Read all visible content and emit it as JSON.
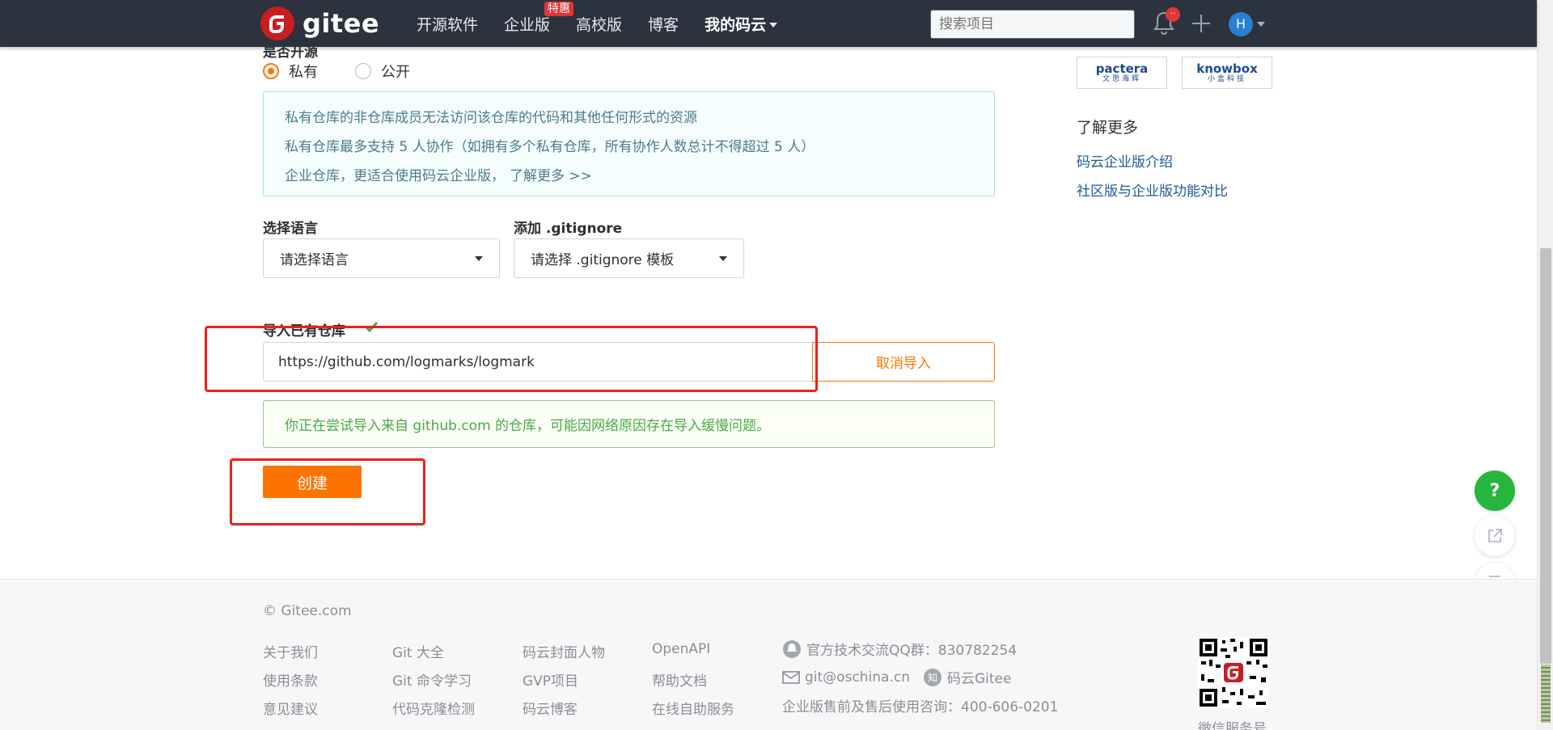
{
  "header": {
    "logo_text": "gitee",
    "nav": [
      "开源软件",
      "企业版",
      "高校版",
      "博客",
      "我的码云"
    ],
    "badge_hot": "特惠",
    "search_placeholder": "搜索项目",
    "avatar_letter": "H"
  },
  "visibility": {
    "private_label": "私有",
    "public_label": "公开",
    "selected": "private"
  },
  "info_box": {
    "line1": "私有仓库的非仓库成员无法访问该仓库的代码和其他任何形式的资源",
    "line2": "私有仓库最多支持 5 人协作（如拥有多个私有仓库，所有协作人数总计不得超过 5 人）",
    "line3": "企业仓库，更适合使用码云企业版，",
    "link": "了解更多 >>"
  },
  "language": {
    "label": "选择语言",
    "value": "请选择语言"
  },
  "gitignore": {
    "label": "添加 .gitignore",
    "value": "请选择 .gitignore 模板"
  },
  "import": {
    "label": "导入已有仓库",
    "url": "https://github.com/logmarks/logmark",
    "cancel_label": "取消导入",
    "notice": "你正在尝试导入来自 github.com 的仓库，可能因网络原因存在导入缓慢问题。"
  },
  "create_label": "创建",
  "sidebar": {
    "partners": [
      {
        "name": "pactera",
        "sub": "文思海辉"
      },
      {
        "name": "knowbox",
        "sub": "小盒科技"
      }
    ],
    "learn_more_title": "了解更多",
    "links": [
      "码云企业版介绍",
      "社区版与企业版功能对比"
    ]
  },
  "floating": {
    "help_label": "?"
  },
  "footer": {
    "copyright": "© Gitee.com",
    "columns": [
      [
        "关于我们",
        "使用条款",
        "意见建议"
      ],
      [
        "Git 大全",
        "Git 命令学习",
        "代码克隆检测"
      ],
      [
        "码云封面人物",
        "GVP项目",
        "码云博客"
      ],
      [
        "OpenAPI",
        "帮助文档",
        "在线自助服务"
      ]
    ],
    "qq_group": "官方技术交流QQ群：830782254",
    "email": "git@oschina.cn",
    "zhihu": "码云Gitee",
    "sales": "企业版售前及售后使用咨询：400-606-0201",
    "qr_caption": "微信服务号"
  },
  "colors": {
    "accent": "#fe7300",
    "header_bg": "#2c323e",
    "brand_red": "#c71d23",
    "success_green": "#49a84b",
    "annotation_red": "#e8231a"
  }
}
